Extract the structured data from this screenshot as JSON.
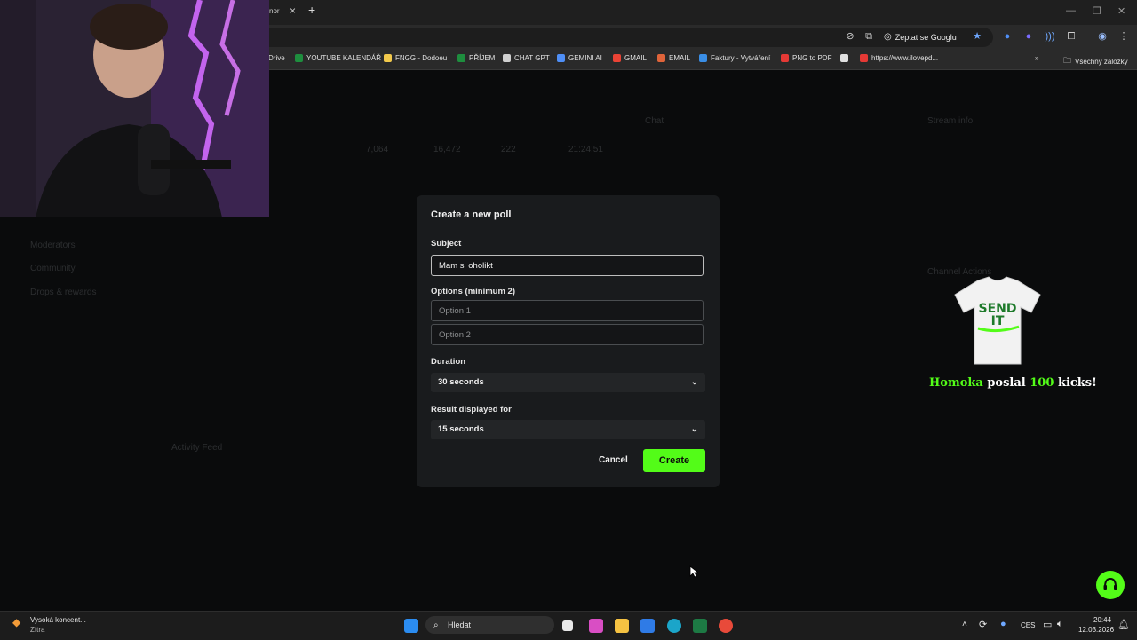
{
  "browser": {
    "tab_fragment": "nor",
    "ask_google": "Zeptat se Googlu",
    "bookmarks": [
      {
        "label": "Drive",
        "color": "#2a2a2a"
      },
      {
        "label": "YOUTUBE KALENDÁŘ",
        "color": "#1e8e3e"
      },
      {
        "label": "FNGG - Dodoeu",
        "color": "#f2c94c"
      },
      {
        "label": "PŘÍJEM",
        "color": "#1e8e3e"
      },
      {
        "label": "CHAT GPT",
        "color": "#d0d0d0"
      },
      {
        "label": "GEMINI AI",
        "color": "#4f8ff7"
      },
      {
        "label": "GMAIL",
        "color": "#ea4335"
      },
      {
        "label": "EMAIL",
        "color": "#e0643a"
      },
      {
        "label": "Faktury - Vytváření",
        "color": "#3a8ee6"
      },
      {
        "label": "PNG to PDF",
        "color": "#e53935"
      },
      {
        "label": "",
        "color": "#e0e0e0"
      },
      {
        "label": "https://www.ilovepd...",
        "color": "#e53935"
      }
    ],
    "all_bookmarks": "Všechny záložky"
  },
  "modal": {
    "title": "Create a new poll",
    "subject_label": "Subject",
    "subject_value": "Mam si oholikt ",
    "options_label": "Options (minimum 2)",
    "option1_placeholder": "Option 1",
    "option2_placeholder": "Option 2",
    "duration_label": "Duration",
    "duration_value": "30 seconds",
    "result_label": "Result displayed for",
    "result_value": "15 seconds",
    "cancel": "Cancel",
    "create": "Create"
  },
  "alert": {
    "shirt_text": "SEND IT",
    "name": "Homoka",
    "verb": "poslal",
    "amount": "100",
    "unit": "kicks!"
  },
  "taskbar": {
    "notification_title": "Vysoká koncent...",
    "notification_sub": "Zítra",
    "search_placeholder": "Hledat",
    "language": "CES",
    "time": "20:44",
    "date": "12.03.2026"
  },
  "accent": "#53fc18"
}
